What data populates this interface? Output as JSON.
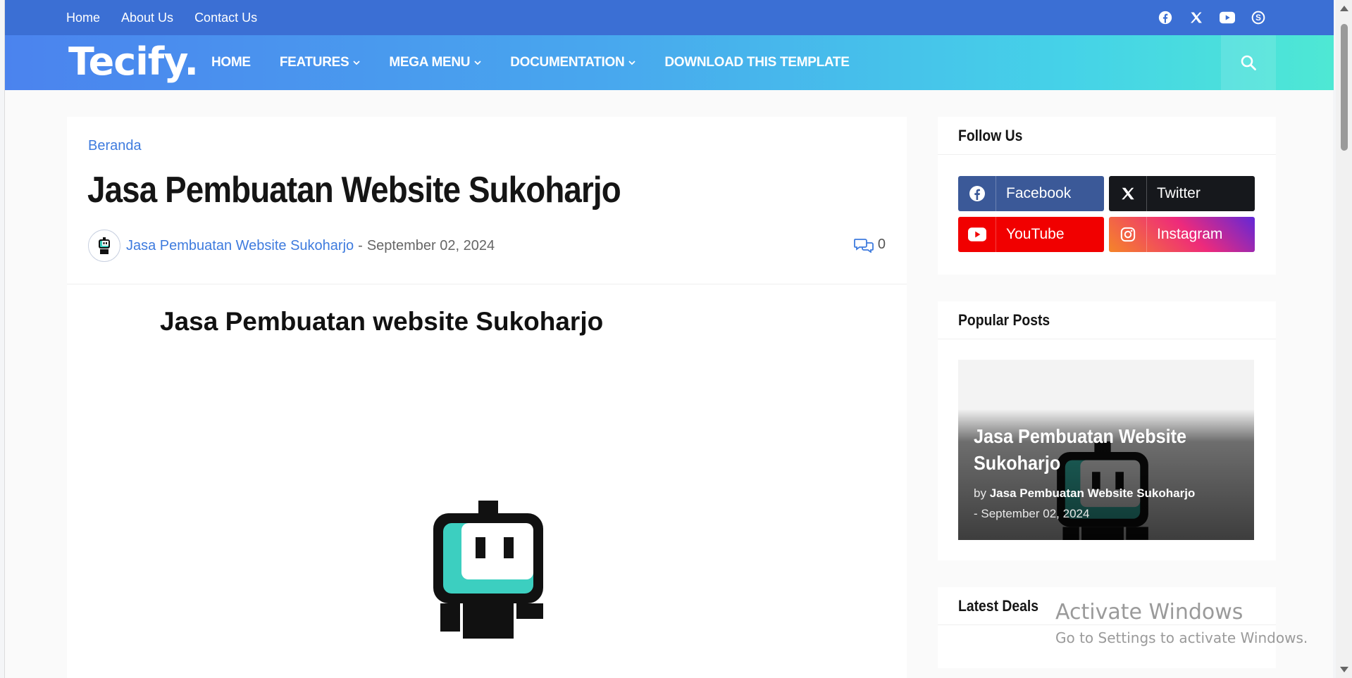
{
  "topbar": {
    "links": [
      "Home",
      "About Us",
      "Contact Us"
    ],
    "social_icons": [
      "facebook-icon",
      "x-icon",
      "youtube-icon",
      "skype-icon"
    ]
  },
  "header": {
    "logo": "Tecify.",
    "nav": [
      {
        "label": "HOME",
        "dropdown": false
      },
      {
        "label": "FEATURES",
        "dropdown": true
      },
      {
        "label": "MEGA MENU",
        "dropdown": true
      },
      {
        "label": "DOCUMENTATION",
        "dropdown": true
      },
      {
        "label": "DOWNLOAD THIS TEMPLATE",
        "dropdown": false
      }
    ],
    "search_icon": "search-icon"
  },
  "article": {
    "breadcrumb": "Beranda",
    "title": "Jasa Pembuatan Website Sukoharjo",
    "author": "Jasa Pembuatan Website Sukoharjo",
    "separator": "-",
    "date": "September 02, 2024",
    "comment_count": "0",
    "content_heading": "Jasa Pembuatan website Sukoharjo"
  },
  "sidebar": {
    "follow": {
      "title": "Follow Us",
      "buttons": [
        {
          "label": "Facebook",
          "icon": "facebook-icon",
          "color": "#3b5998"
        },
        {
          "label": "Twitter",
          "icon": "x-icon",
          "color": "#16181c"
        },
        {
          "label": "YouTube",
          "icon": "youtube-icon",
          "color": "#f10000"
        },
        {
          "label": "Instagram",
          "icon": "instagram-icon",
          "color": "#e1306c"
        }
      ]
    },
    "popular": {
      "title": "Popular Posts",
      "post_title": "Jasa Pembuatan Website Sukoharjo",
      "by": "by",
      "post_author": "Jasa Pembuatan Website Sukoharjo",
      "post_date": "- September 02, 2024"
    },
    "deals": {
      "title": "Latest Deals"
    }
  },
  "watermark": {
    "line1": "Activate Windows",
    "line2": "Go to Settings to activate Windows."
  },
  "colors": {
    "topbar": "#3b6fd4",
    "accent": "#3e7bde",
    "robot_teal": "#3ccfc0"
  }
}
